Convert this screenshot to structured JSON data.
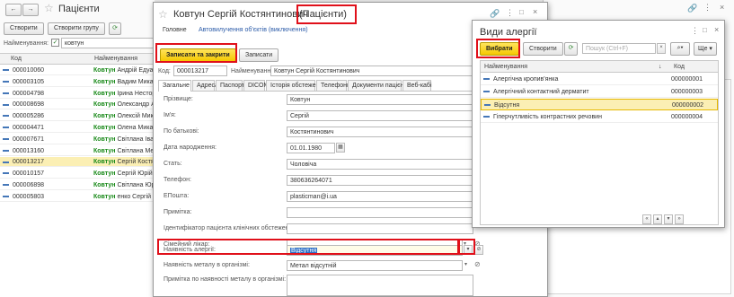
{
  "back_window": {
    "title": "Пацієнти",
    "create_label": "Створити",
    "create_group_label": "Створити групу",
    "filter_label": "Найменування:",
    "filter_value": "ковтун",
    "columns": {
      "code": "Код",
      "name": "Найменування"
    },
    "rows": [
      {
        "code": "000010060",
        "name_bold": "Ковтун",
        "name_rest": "Андрій Едуа",
        "selected": false
      },
      {
        "code": "000003105",
        "name_bold": "Ковтун",
        "name_rest": "Вадим Мика",
        "selected": false
      },
      {
        "code": "000004798",
        "name_bold": "Ковтун",
        "name_rest": "Ірина Нестор",
        "selected": false
      },
      {
        "code": "000008698",
        "name_bold": "Ковтун",
        "name_rest": "Олександр А",
        "selected": false
      },
      {
        "code": "000005286",
        "name_bold": "Ковтун",
        "name_rest": "Олексій Мик",
        "selected": false
      },
      {
        "code": "000004471",
        "name_bold": "Ковтун",
        "name_rest": "Олена Мика",
        "selected": false
      },
      {
        "code": "000007671",
        "name_bold": "Ковтун",
        "name_rest": "Світлана Іва",
        "selected": false
      },
      {
        "code": "000013160",
        "name_bold": "Ковтун",
        "name_rest": "Світлана Ме",
        "selected": false
      },
      {
        "code": "000013217",
        "name_bold": "Ковтун",
        "name_rest": "Сергій Костя",
        "selected": true
      },
      {
        "code": "000010157",
        "name_bold": "Ковтун",
        "name_rest": "Сергій Юрій",
        "selected": false
      },
      {
        "code": "000006898",
        "name_bold": "Ковтун",
        "name_rest": "Світлана Юр",
        "selected": false
      },
      {
        "code": "000005803",
        "name_bold": "Ковтун",
        "name_rest": "енко Сергій",
        "selected": false
      }
    ]
  },
  "patient_form": {
    "title_name": "Ковтун Сергій Костянтинович",
    "title_suffix": "(Пацієнти)",
    "nav_main": "Головне",
    "nav_auto": "Автовилучення об'єктів (виключення)",
    "save_close_label": "Записати та закрити",
    "save_label": "Записати",
    "code_label": "Код:",
    "code_value": "000013217",
    "name_label": "Найменування:",
    "name_value": "Ковтун Сергій Костянтинович",
    "tabs": [
      "Загальне",
      "Адреса",
      "Паспорт",
      "DICOM",
      "Історія обстежень",
      "Телефони",
      "Документи пацієнта",
      "Веб-кабі"
    ],
    "fields": {
      "surname": {
        "label": "Прізвище:",
        "value": "Ковтун"
      },
      "first_name": {
        "label": "Ім'я:",
        "value": "Сергій"
      },
      "patronymic": {
        "label": "По батькові:",
        "value": "Костянтинович"
      },
      "birth_date": {
        "label": "Дата народження:",
        "value": "01.01.1980"
      },
      "sex": {
        "label": "Стать:",
        "value": "Чоловіча"
      },
      "phone": {
        "label": "Телефон:",
        "value": "380636264071"
      },
      "email": {
        "label": "EПошта:",
        "value": "plasticman@i.ua"
      },
      "note": {
        "label": "Примітка:",
        "value": ""
      },
      "clinic_id": {
        "label": "Ідентифікатор пацієнта клінічних обстежень:",
        "value": ""
      },
      "family_doctor": {
        "label": "Сімейний лікар:",
        "value": ""
      },
      "allergy": {
        "label": "Наявність алергії:",
        "value": "Відсутня"
      },
      "metal": {
        "label": "Наявність металу в організмі:",
        "value": "Метал відсутній"
      },
      "metal_note": {
        "label": "Примітка по наявності металу в організмі:",
        "value": ""
      }
    }
  },
  "allergy_window": {
    "title": "Види алергії",
    "select_label": "Вибрати",
    "create_label": "Створити",
    "search_placeholder": "Пошук (Ctrl+F)",
    "more_label": "Ще",
    "columns": {
      "name": "Найменування",
      "code": "Код"
    },
    "rows": [
      {
        "name": "Алергічна кропив'янка",
        "code": "000000001",
        "selected": false
      },
      {
        "name": "Алергічний контактний дерматит",
        "code": "000000003",
        "selected": false
      },
      {
        "name": "Відсутня",
        "code": "000000002",
        "selected": true
      },
      {
        "name": "Гіперчутливість контрастних речовин",
        "code": "000000004",
        "selected": false
      }
    ]
  },
  "colors": {
    "accent_yellow": "#f5c800",
    "highlight_red": "#e0101a",
    "selection": "#fbefb4",
    "link_blue": "#2a5aa8",
    "name_green": "#1a8a1a"
  }
}
